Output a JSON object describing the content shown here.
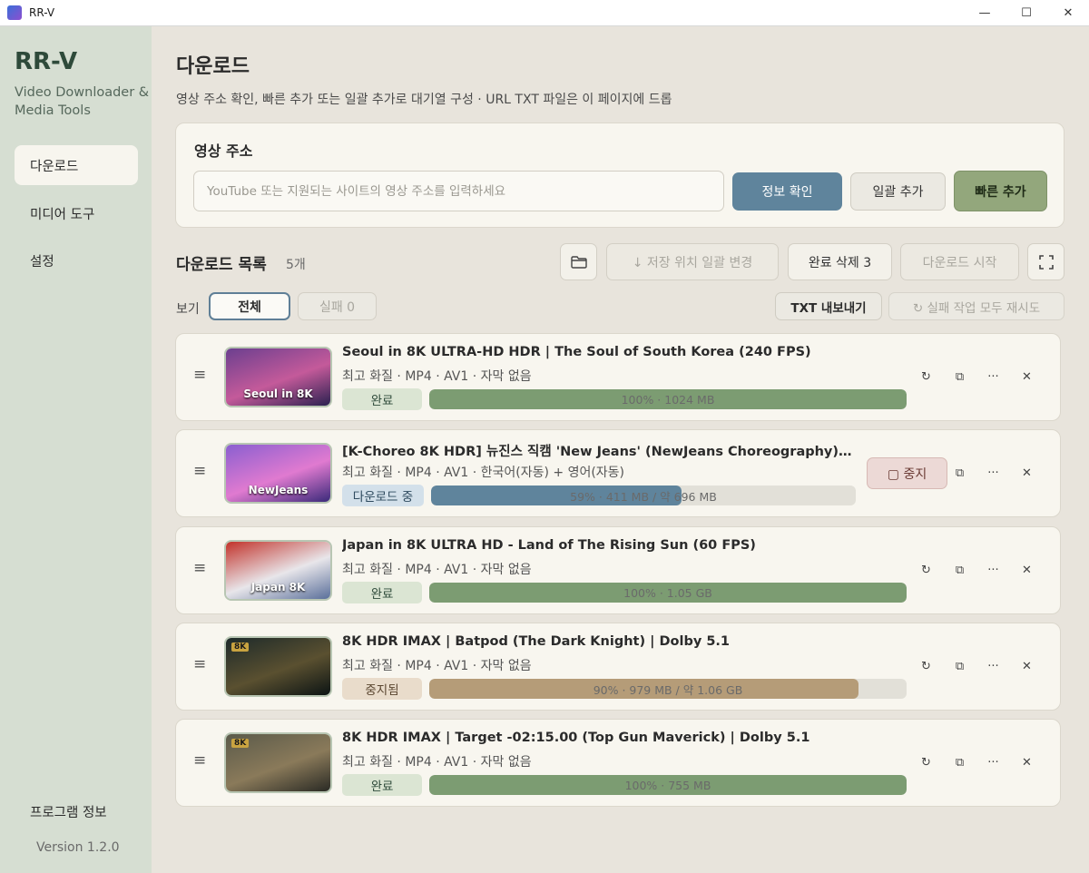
{
  "window": {
    "title": "RR-V",
    "controls": [
      "—",
      "☐",
      "✕"
    ]
  },
  "sidebar": {
    "brand": "RR-V",
    "subtitle": "Video Downloader & Media Tools",
    "nav": [
      {
        "label": "다운로드",
        "active": true
      },
      {
        "label": "미디어 도구",
        "active": false
      },
      {
        "label": "설정",
        "active": false
      }
    ],
    "about": "프로그램 정보",
    "version": "Version 1.2.0"
  },
  "header": {
    "title": "다운로드",
    "description": "영상 주소 확인, 빠른 추가 또는 일괄 추가로 대기열 구성 · URL TXT 파일은 이 페이지에 드롭"
  },
  "url_card": {
    "label": "영상 주소",
    "placeholder": "YouTube 또는 지원되는 사이트의 영상 주소를 입력하세요",
    "value": "",
    "info_button": "정보 확인",
    "batch_button": "일괄 추가",
    "quick_button": "빠른 추가"
  },
  "list": {
    "title": "다운로드 목록",
    "count": "5개",
    "change_location": "↓ 저장 위치 일괄 변경",
    "clear_done": "완료 삭제 3",
    "start": "다운로드 시작",
    "view_label": "보기",
    "filter_all": "전체",
    "filter_failed": "실패 0",
    "export_txt": "TXT 내보내기",
    "retry_all": "↻ 실패 작업 모두 재시도"
  },
  "items": [
    {
      "title": "Seoul in 8K ULTRA-HD HDR | The Soul of South Korea (240 FPS)",
      "meta": "최고 화질 · MP4 · AV1 · 자막 없음",
      "status": "완료",
      "status_kind": "done",
      "progress": 1.0,
      "progress_text": "100% · 1024 MB",
      "thumb_text": "Seoul in 8K",
      "thumb_colors": [
        "#6b3f8f",
        "#c45a9a",
        "#2b2150"
      ]
    },
    {
      "title": "[K-Choreo 8K HDR] 뉴진스 직캠 'New Jeans' (NewJeans Choreography) @M...",
      "meta": "최고 화질 · MP4 · AV1 · 한국어(자동) + 영어(자동)",
      "status": "다운로드 중",
      "status_kind": "running",
      "progress": 0.59,
      "progress_text": "59% · 411 MB / 약 696 MB",
      "thumb_text": "NewJeans",
      "thumb_colors": [
        "#8a5fd0",
        "#e07ad0",
        "#3a2a7a"
      ],
      "stop_label": "▢ 중지"
    },
    {
      "title": "Japan in 8K ULTRA HD - Land of The Rising Sun (60 FPS)",
      "meta": "최고 화질 · MP4 · AV1 · 자막 없음",
      "status": "완료",
      "status_kind": "done",
      "progress": 1.0,
      "progress_text": "100% · 1.05 GB",
      "thumb_text": "Japan 8K",
      "thumb_colors": [
        "#c2322a",
        "#e8e6ea",
        "#5a6f9a"
      ]
    },
    {
      "title": "8K HDR IMAX | Batpod (The Dark Knight) | Dolby 5.1",
      "meta": "최고 화질 · MP4 · AV1 · 자막 없음",
      "status": "중지됨",
      "status_kind": "paused",
      "progress": 0.9,
      "progress_text": "90% · 979 MB / 약 1.06 GB",
      "thumb_badge": "8K",
      "thumb_colors": [
        "#1d2a2a",
        "#5a5030",
        "#0c1414"
      ]
    },
    {
      "title": "8K HDR IMAX | Target -02:15.00 (Top Gun Maverick) | Dolby 5.1",
      "meta": "최고 화질 · MP4 · AV1 · 자막 없음",
      "status": "완료",
      "status_kind": "done",
      "progress": 1.0,
      "progress_text": "100% · 755 MB",
      "thumb_badge": "8K",
      "thumb_colors": [
        "#5a5a4a",
        "#8a7a5a",
        "#2a2a24"
      ]
    }
  ],
  "row_actions": {
    "retry": "↻",
    "copy": "⧉",
    "more": "···",
    "remove": "✕"
  }
}
